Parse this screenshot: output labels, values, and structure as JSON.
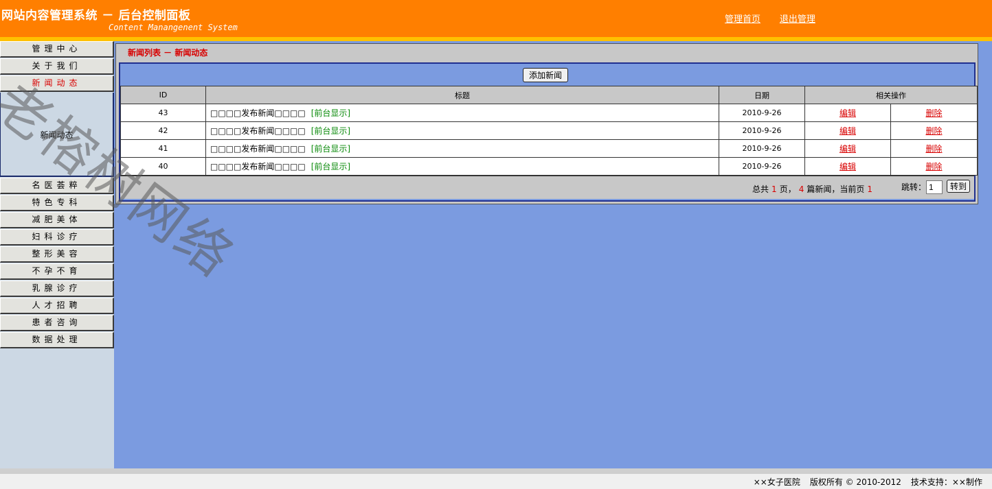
{
  "header": {
    "title": "网站内容管理系统 － 后台控制面板",
    "subtitle": "Content Manangenent System",
    "links": [
      "管理首页",
      "退出管理"
    ],
    "colors": {
      "bar": "#ff7f00",
      "stripe": "#ffc000"
    }
  },
  "sidebar": {
    "items_top": [
      "管理中心",
      "关于我们",
      "新闻动态"
    ],
    "active_item": "新闻动态",
    "submenu": [
      "新闻动态"
    ],
    "items_bottom": [
      "名医荟粹",
      "特色专科",
      "减肥美体",
      "妇科诊疗",
      "整形美容",
      "不孕不育",
      "乳腺诊疗",
      "人才招聘",
      "患者咨询",
      "数据处理"
    ]
  },
  "main": {
    "breadcrumb": "新闻列表 － 新闻动态",
    "add_button": "添加新闻",
    "columns": [
      "ID",
      "标题",
      "日期",
      "相关操作"
    ],
    "rows": [
      {
        "id": "43",
        "title": "□□□□发布新闻□□□□",
        "tag": "[前台显示]",
        "date": "2010-9-26",
        "edit": "编辑",
        "delete": "删除"
      },
      {
        "id": "42",
        "title": "□□□□发布新闻□□□□",
        "tag": "[前台显示]",
        "date": "2010-9-26",
        "edit": "编辑",
        "delete": "删除"
      },
      {
        "id": "41",
        "title": "□□□□发布新闻□□□□",
        "tag": "[前台显示]",
        "date": "2010-9-26",
        "edit": "编辑",
        "delete": "删除"
      },
      {
        "id": "40",
        "title": "□□□□发布新闻□□□□",
        "tag": "[前台显示]",
        "date": "2010-9-26",
        "edit": "编辑",
        "delete": "删除"
      }
    ],
    "pager": {
      "total_prefix": "总共",
      "total_pages": "1",
      "pages_suffix": "页，",
      "total_items": "4",
      "items_suffix": "篇新闻，当前页",
      "current_page": "1",
      "jump_label": "跳转：",
      "jump_value": "1",
      "go_button": "转到"
    }
  },
  "footer": {
    "owner": "××女子医院",
    "copyright": "版权所有 © 2010-2012",
    "support": "技术支持：××制作"
  },
  "watermark": "老榕树网络"
}
